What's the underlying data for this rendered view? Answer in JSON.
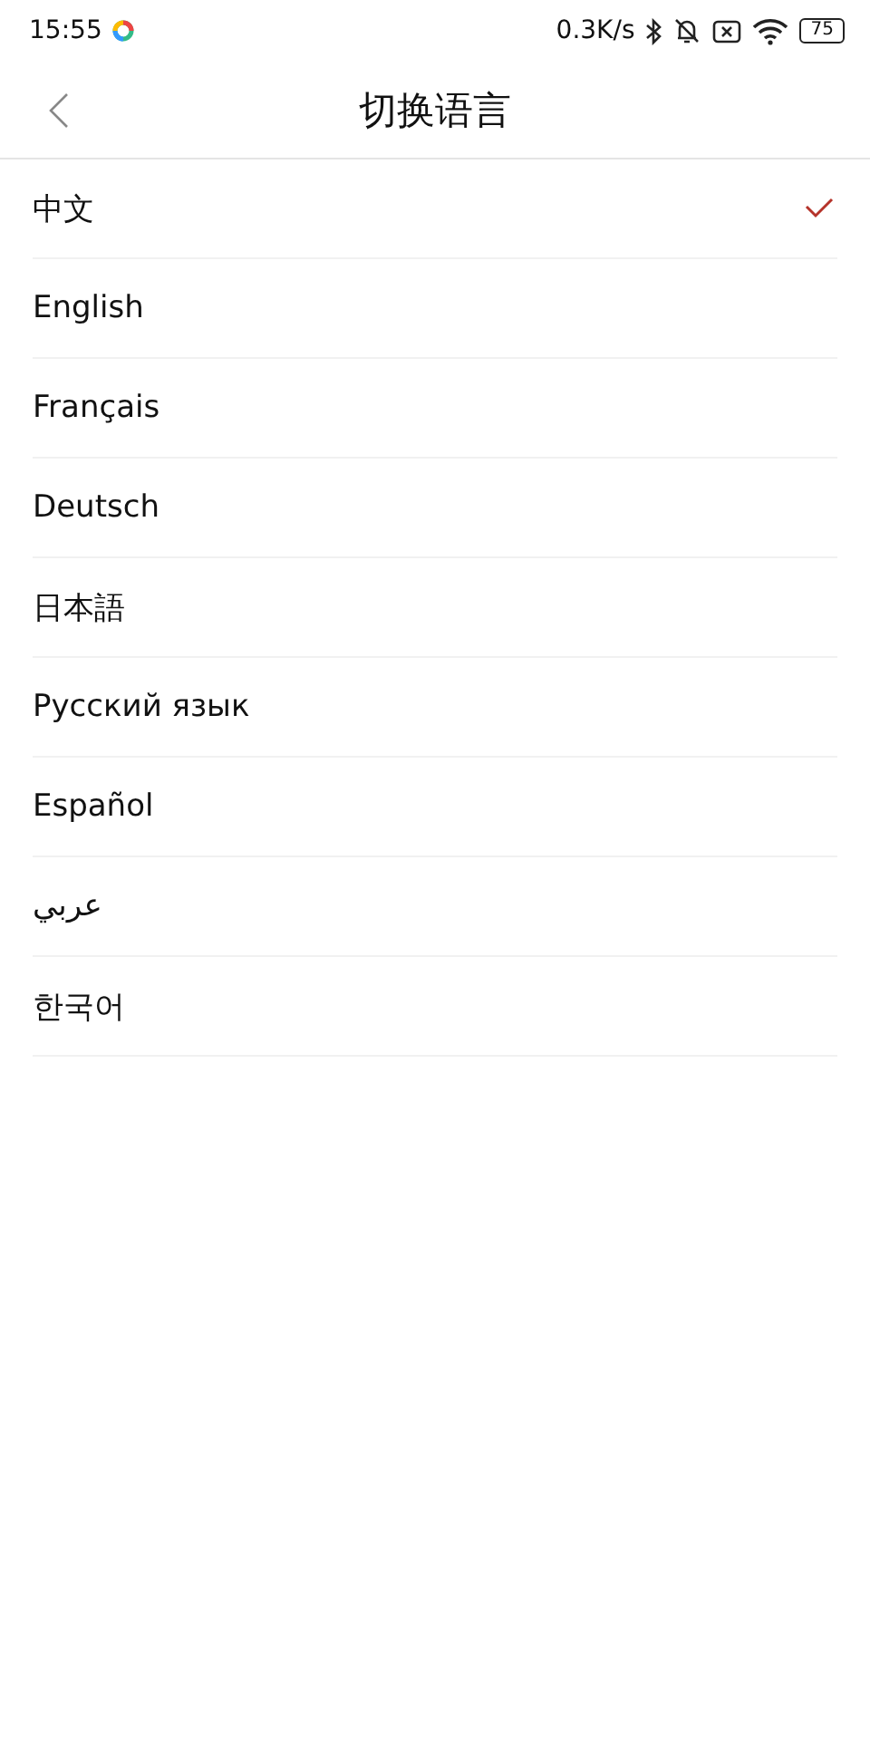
{
  "status_bar": {
    "time": "15:55",
    "network_speed": "0.3K/s",
    "battery": "75"
  },
  "header": {
    "title": "切换语言"
  },
  "languages": [
    {
      "label": "中文",
      "selected": true
    },
    {
      "label": "English",
      "selected": false
    },
    {
      "label": "Français",
      "selected": false
    },
    {
      "label": "Deutsch",
      "selected": false
    },
    {
      "label": "日本語",
      "selected": false
    },
    {
      "label": "Русский язык",
      "selected": false
    },
    {
      "label": "Español",
      "selected": false
    },
    {
      "label": "عربي",
      "selected": false
    },
    {
      "label": "한국어",
      "selected": false
    }
  ]
}
